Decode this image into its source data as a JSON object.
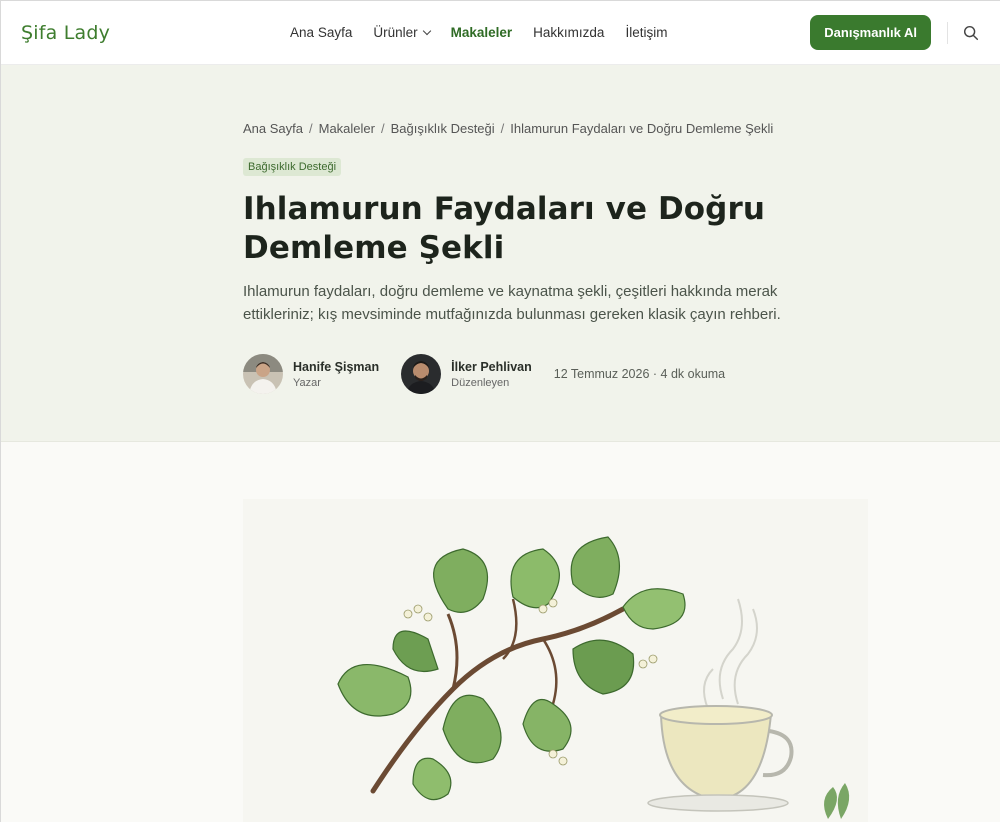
{
  "header": {
    "logo": "Şifa Lady",
    "nav": [
      {
        "label": "Ana Sayfa"
      },
      {
        "label": "Ürünler"
      },
      {
        "label": "Makaleler"
      },
      {
        "label": "Hakkımızda"
      },
      {
        "label": "İletişim"
      }
    ],
    "cta_label": "Danışmanlık Al"
  },
  "breadcrumb": [
    "Ana Sayfa",
    "Makaleler",
    "Bağışıklık Desteği",
    "Ihlamurun Faydaları ve Doğru Demleme Şekli"
  ],
  "article": {
    "tag": "Bağışıklık Desteği",
    "title": "Ihlamurun Faydaları ve Doğru Demleme Şekli",
    "lead": "Ihlamurun faydaları, doğru demleme ve kaynatma şekli, çeşitleri hakkında merak ettikleriniz; kış mevsiminde mutfağınızda bulunması gereken klasik çayın rehberi.",
    "authors": [
      {
        "name": "Hanife Şişman",
        "role": "Yazar"
      },
      {
        "name": "İlker Pehlivan",
        "role": "Düzenleyen"
      }
    ],
    "date_read": "12 Temmuz 2026 · 4 dk okuma"
  },
  "colors": {
    "brand": "#3a7a2e",
    "hero_bg": "#f1f3eb"
  }
}
